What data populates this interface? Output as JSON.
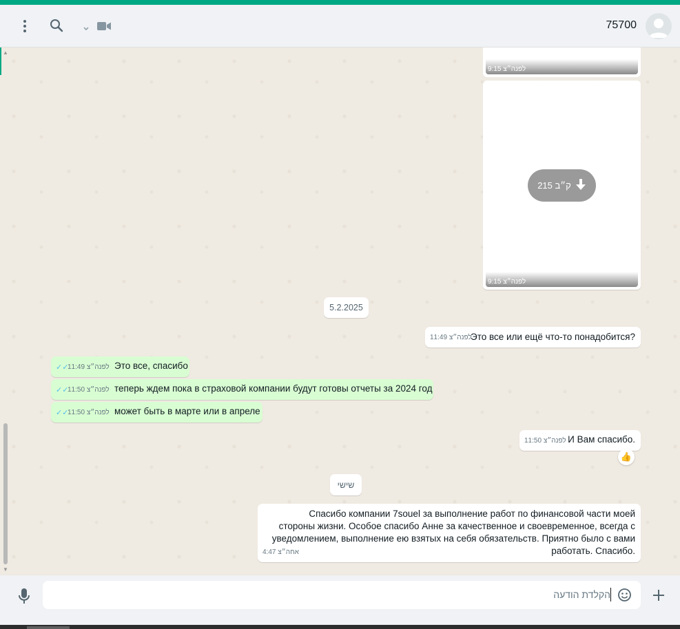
{
  "header": {
    "contact_name": "75700",
    "icons": [
      "menu-icon",
      "search-icon",
      "chevron-down-icon",
      "video-call-icon",
      "avatar"
    ]
  },
  "media": [
    {
      "time": "9:15 לפנה״צ"
    },
    {
      "time": "9:15 לפנה״צ",
      "size": "215 ק״ב"
    }
  ],
  "date_separator": "5.2.2025",
  "day_separator": "שישי",
  "messages": [
    {
      "direction": "in",
      "text": "Это все или ещё что-то понадобится?",
      "time": "11:49 לפנה״צ"
    },
    {
      "direction": "out",
      "text": "Это все, спасибо",
      "time": "11:49 לפנה״צ"
    },
    {
      "direction": "out",
      "text": "теперь ждем пока в страховой компании будут готовы отчеты за 2024 год",
      "time": "11:50 לפנה״צ"
    },
    {
      "direction": "out",
      "text": "может быть в марте или в апреле",
      "time": "11:50 לפנה״צ"
    },
    {
      "direction": "in",
      "text": "И Вам спасибо.",
      "time": "11:50 לפנה״צ",
      "reaction": "👍"
    },
    {
      "direction": "in",
      "text": "Спасибо компании 7souel за выполнение работ по финансовой части моей стороны жизни. Особое спасибо Анне за качественное и своевременное, всегда с уведомлением, выполнение ею взятых на себя обязательств. Приятно было с вами работать. Спасибо.",
      "time": "4:47 אחה״צ"
    }
  ],
  "composer": {
    "placeholder": "הקלדת הודעה",
    "icons": [
      "mic-icon",
      "sticker-icon",
      "plus-icon"
    ]
  },
  "colors": {
    "accent": "#00a884",
    "outgoing_bubble": "#d9fdd3",
    "incoming_bubble": "#ffffff",
    "chat_background": "#efeae2",
    "read_ticks": "#53bdeb"
  }
}
